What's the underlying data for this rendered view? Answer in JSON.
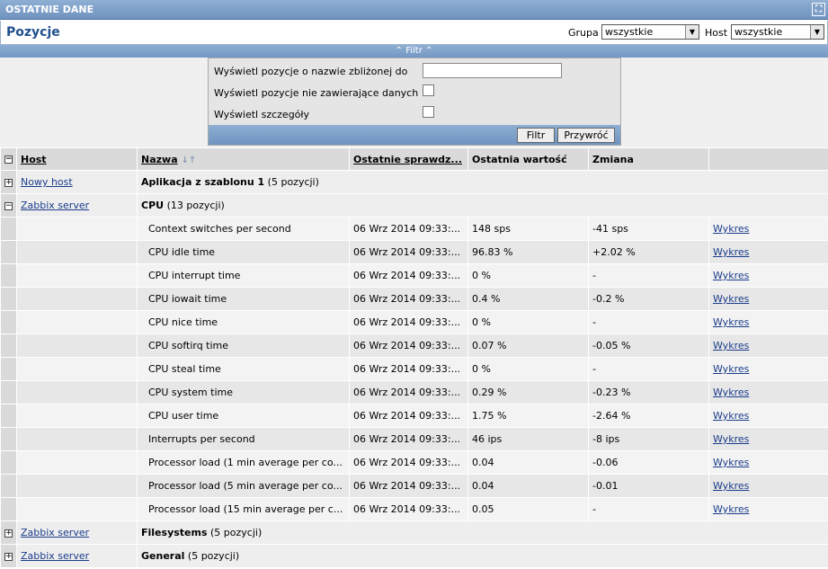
{
  "window": {
    "title": "OSTATNIE DANE"
  },
  "header": {
    "title": "Pozycje",
    "group_label": "Grupa",
    "group_value": "wszystkie",
    "host_label": "Host",
    "host_value": "wszystkie"
  },
  "filter": {
    "toggle_label": "Filtr",
    "name_label": "Wyświetl pozycje o nazwie zbliżonej do",
    "name_value": "",
    "nodata_label": "Wyświetl pozycje nie zawierające danych",
    "details_label": "Wyświetl szczegóły",
    "filter_button": "Filtr",
    "reset_button": "Przywróć"
  },
  "table": {
    "columns": [
      "Host",
      "Nazwa",
      "Ostatnie sprawdz...",
      "Ostatnia wartość",
      "Zmiana"
    ],
    "groups": [
      {
        "toggle": "+",
        "host": "Nowy host",
        "name": "Aplikacja z szablonu 1",
        "count": "(5 pozycji)"
      },
      {
        "toggle": "−",
        "host": "Zabbix server",
        "name": "CPU",
        "count": "(13 pozycji)"
      }
    ],
    "rows": [
      {
        "name": "Context switches per second",
        "last_check": "06 Wrz 2014 09:33:...",
        "value": "148 sps",
        "change": "-41 sps",
        "graph": "Wykres"
      },
      {
        "name": "CPU idle time",
        "last_check": "06 Wrz 2014 09:33:...",
        "value": "96.83 %",
        "change": "+2.02 %",
        "graph": "Wykres"
      },
      {
        "name": "CPU interrupt time",
        "last_check": "06 Wrz 2014 09:33:...",
        "value": "0 %",
        "change": "-",
        "graph": "Wykres"
      },
      {
        "name": "CPU iowait time",
        "last_check": "06 Wrz 2014 09:33:...",
        "value": "0.4 %",
        "change": "-0.2 %",
        "graph": "Wykres"
      },
      {
        "name": "CPU nice time",
        "last_check": "06 Wrz 2014 09:33:...",
        "value": "0 %",
        "change": "-",
        "graph": "Wykres"
      },
      {
        "name": "CPU softirq time",
        "last_check": "06 Wrz 2014 09:33:...",
        "value": "0.07 %",
        "change": "-0.05 %",
        "graph": "Wykres"
      },
      {
        "name": "CPU steal time",
        "last_check": "06 Wrz 2014 09:33:...",
        "value": "0 %",
        "change": "-",
        "graph": "Wykres"
      },
      {
        "name": "CPU system time",
        "last_check": "06 Wrz 2014 09:33:...",
        "value": "0.29 %",
        "change": "-0.23 %",
        "graph": "Wykres"
      },
      {
        "name": "CPU user time",
        "last_check": "06 Wrz 2014 09:33:...",
        "value": "1.75 %",
        "change": "-2.64 %",
        "graph": "Wykres"
      },
      {
        "name": "Interrupts per second",
        "last_check": "06 Wrz 2014 09:33:...",
        "value": "46 ips",
        "change": "-8 ips",
        "graph": "Wykres"
      },
      {
        "name": "Processor load (1 min average per co...",
        "last_check": "06 Wrz 2014 09:33:...",
        "value": "0.04",
        "change": "-0.06",
        "graph": "Wykres"
      },
      {
        "name": "Processor load (5 min average per co...",
        "last_check": "06 Wrz 2014 09:33:...",
        "value": "0.04",
        "change": "-0.01",
        "graph": "Wykres"
      },
      {
        "name": "Processor load (15 min average per c...",
        "last_check": "06 Wrz 2014 09:33:...",
        "value": "0.05",
        "change": "-",
        "graph": "Wykres"
      }
    ],
    "tail_groups": [
      {
        "toggle": "+",
        "host": "Zabbix server",
        "name": "Filesystems",
        "count": "(5 pozycji)"
      },
      {
        "toggle": "+",
        "host": "Zabbix server",
        "name": "General",
        "count": "(5 pozycji)"
      }
    ]
  }
}
